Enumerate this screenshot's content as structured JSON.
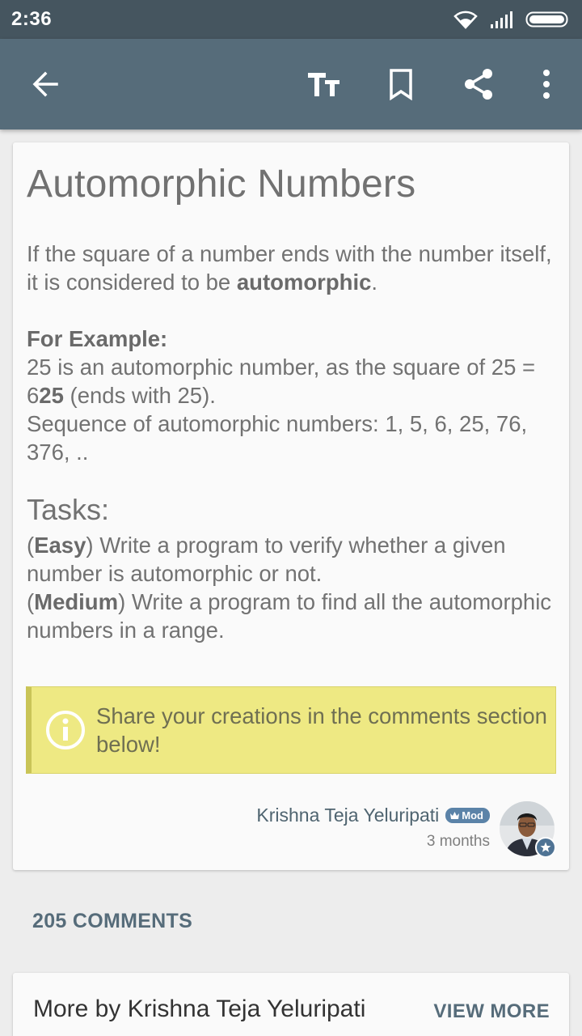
{
  "status_bar": {
    "time": "2:36",
    "icons": [
      "wifi-icon",
      "signal-icon",
      "battery-icon"
    ]
  },
  "toolbar": {
    "icons": [
      "back-arrow-icon",
      "text-size-icon",
      "bookmark-icon",
      "share-icon",
      "more-vert-icon"
    ]
  },
  "article": {
    "title": "Automorphic Numbers",
    "intro_pre": "If the square of a number ends with the number itself, it is considered to be ",
    "intro_bold": "automorphic",
    "intro_post": ".",
    "example_heading": "For Example:",
    "example_line1_pre": "25 is an automorphic number, as the square of 25 = 6",
    "example_line1_bold": "25",
    "example_line1_post": " (ends with 25).",
    "example_line2": "Sequence of automorphic numbers: 1, 5, 6, 25, 76, 376, ..",
    "tasks_heading": "Tasks:",
    "task1_level": "Easy",
    "task1_text": " Write a program to verify whether a given number is automorphic or not.",
    "task2_level": "Medium",
    "task2_text": " Write a program to find all the automorphic numbers in a range.",
    "notice": "Share your creations in the comments section below!"
  },
  "author": {
    "name": "Krishna Teja Yeluripati",
    "badge": "Mod",
    "time_ago": "3 months"
  },
  "comments": {
    "count_label": "205 COMMENTS"
  },
  "more_by": {
    "title": "More by Krishna Teja Yeluripati",
    "view_more": "VIEW MORE"
  },
  "colors": {
    "status_bar": "#45555f",
    "toolbar": "#566c7a",
    "notice_bg": "#eee983",
    "notice_border": "#c9c457",
    "mod_badge": "#5b83a8"
  }
}
